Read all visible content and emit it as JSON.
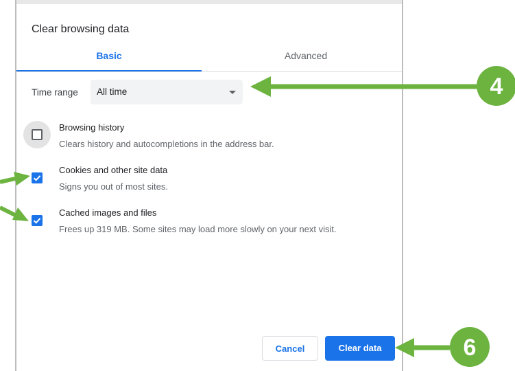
{
  "dialog": {
    "title": "Clear browsing data",
    "tabs": [
      {
        "label": "Basic",
        "active": true
      },
      {
        "label": "Advanced",
        "active": false
      }
    ],
    "time_range": {
      "label": "Time range",
      "value": "All time"
    },
    "options": [
      {
        "title": "Browsing history",
        "description": "Clears history and autocompletions in the address bar.",
        "checked": false
      },
      {
        "title": "Cookies and other site data",
        "description": "Signs you out of most sites.",
        "checked": true
      },
      {
        "title": "Cached images and files",
        "description": "Frees up 319 MB. Some sites may load more slowly on your next visit.",
        "checked": true
      }
    ],
    "buttons": {
      "cancel": "Cancel",
      "clear": "Clear data"
    }
  },
  "annotations": {
    "marker_time_range": "4",
    "marker_clear_data": "6",
    "color": "#6cb33f"
  },
  "colors": {
    "accent": "#1a73e8",
    "select_bg": "#f1f3f4"
  }
}
